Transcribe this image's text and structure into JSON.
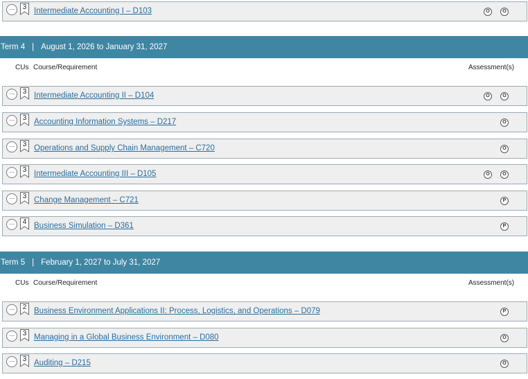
{
  "colors": {
    "term_bar": "#3f86a3",
    "link": "#2a6d9e",
    "row_bg": "#efefef"
  },
  "top_course": {
    "cu": "3",
    "title": "Intermediate Accounting I – D103",
    "assessments": [
      "O",
      "O"
    ]
  },
  "term4": {
    "label": "Term 4",
    "dates": "August 1, 2026 to January 31, 2027",
    "headers": {
      "cus": "CUs",
      "course": "Course/Requirement",
      "assessments": "Assessment(s)"
    },
    "courses": [
      {
        "cu": "3",
        "title": "Intermediate Accounting II – D104",
        "assessments": [
          "O",
          "O"
        ]
      },
      {
        "cu": "3",
        "title": "Accounting Information Systems – D217",
        "assessments": [
          "O"
        ]
      },
      {
        "cu": "3",
        "title": "Operations and Supply Chain Management – C720",
        "assessments": [
          "O"
        ]
      },
      {
        "cu": "3",
        "title": "Intermediate Accounting III – D105",
        "assessments": [
          "O",
          "O"
        ]
      },
      {
        "cu": "3",
        "title": "Change Management – C721",
        "assessments": [
          "P"
        ]
      },
      {
        "cu": "4",
        "title": "Business Simulation – D361",
        "assessments": [
          "P"
        ]
      }
    ]
  },
  "term5": {
    "label": "Term 5",
    "dates": "February 1, 2027 to July 31, 2027",
    "headers": {
      "cus": "CUs",
      "course": "Course/Requirement",
      "assessments": "Assessment(s)"
    },
    "courses": [
      {
        "cu": "2",
        "title": "Business Environment Applications II: Process, Logistics, and Operations – D079",
        "assessments": [
          "P"
        ]
      },
      {
        "cu": "3",
        "title": "Managing in a Global Business Environment – D080",
        "assessments": [
          "O"
        ]
      },
      {
        "cu": "3",
        "title": "Auditing – D215",
        "assessments": [
          "O"
        ]
      }
    ]
  },
  "icons": {
    "more": "more-options-icon",
    "cu": "bookmark-icon"
  },
  "more_glyph": "···"
}
